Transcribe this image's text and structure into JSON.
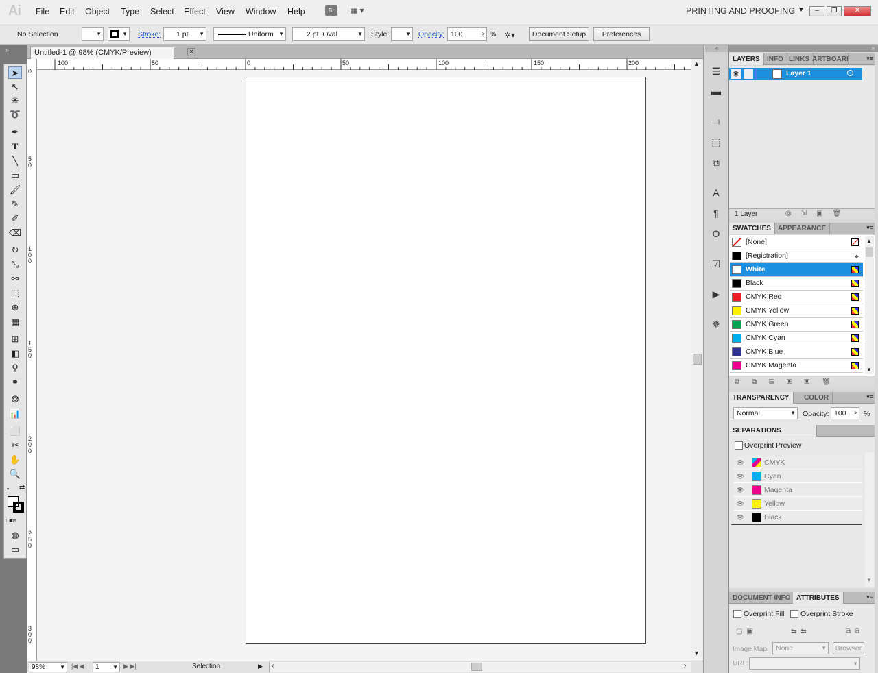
{
  "app": {
    "logo": "Ai",
    "workspace": "PRINTING AND PROOFING",
    "bridge_label": "Br"
  },
  "menu": [
    "File",
    "Edit",
    "Object",
    "Type",
    "Select",
    "Effect",
    "View",
    "Window",
    "Help"
  ],
  "control_bar": {
    "selection": "No Selection",
    "stroke_label": "Stroke:",
    "stroke_value": "1 pt",
    "profile": "Uniform",
    "brush": "2 pt. Oval",
    "style_label": "Style:",
    "opacity_label": "Opacity:",
    "opacity_value": "100",
    "percent": "%",
    "document_setup": "Document Setup",
    "preferences": "Preferences"
  },
  "document": {
    "tab_title": "Untitled-1 @ 98% (CMYK/Preview)",
    "h_ruler": [
      "100",
      "50",
      "0",
      "50",
      "100",
      "150",
      "200"
    ],
    "v_ruler": [
      "0",
      "5 0",
      "1 0 0",
      "1 5 0",
      "2 0 0",
      "2 5 0",
      "3 0 0"
    ],
    "zoom": "98%",
    "artboard_index": "1",
    "status": "Selection"
  },
  "layers": {
    "tabs": [
      "LAYERS",
      "INFO",
      "LINKS",
      "ARTBOARD"
    ],
    "layer_name": "Layer 1",
    "count": "1 Layer"
  },
  "swatches": {
    "tabs": [
      "SWATCHES",
      "APPEARANCE"
    ],
    "items": [
      {
        "name": "[None]",
        "color": "#ffffff"
      },
      {
        "name": "[Registration]",
        "color": "#000000"
      },
      {
        "name": "White",
        "color": "#ffffff"
      },
      {
        "name": "Black",
        "color": "#000000"
      },
      {
        "name": "CMYK Red",
        "color": "#ee1c24"
      },
      {
        "name": "CMYK Yellow",
        "color": "#fff200"
      },
      {
        "name": "CMYK Green",
        "color": "#00a651"
      },
      {
        "name": "CMYK Cyan",
        "color": "#00aeef"
      },
      {
        "name": "CMYK Blue",
        "color": "#2e3192"
      },
      {
        "name": "CMYK Magenta",
        "color": "#ec008c"
      }
    ]
  },
  "transparency": {
    "tabs": [
      "TRANSPARENCY",
      "COLOR"
    ],
    "mode": "Normal",
    "opacity_label": "Opacity:",
    "opacity_value": "100",
    "percent": "%"
  },
  "separations": {
    "title": "SEPARATIONS PREVIEW",
    "overprint_preview": "Overprint Preview",
    "plates": [
      {
        "name": "CMYK",
        "color": "#cccccc"
      },
      {
        "name": "Cyan",
        "color": "#00aeef"
      },
      {
        "name": "Magenta",
        "color": "#ec008c"
      },
      {
        "name": "Yellow",
        "color": "#fff200"
      },
      {
        "name": "Black",
        "color": "#000000"
      }
    ]
  },
  "attributes": {
    "tabs": [
      "DOCUMENT INFO",
      "ATTRIBUTES"
    ],
    "overprint_fill": "Overprint Fill",
    "overprint_stroke": "Overprint Stroke",
    "image_map_label": "Image Map:",
    "image_map_value": "None",
    "browser": "Browser",
    "url_label": "URL:"
  }
}
